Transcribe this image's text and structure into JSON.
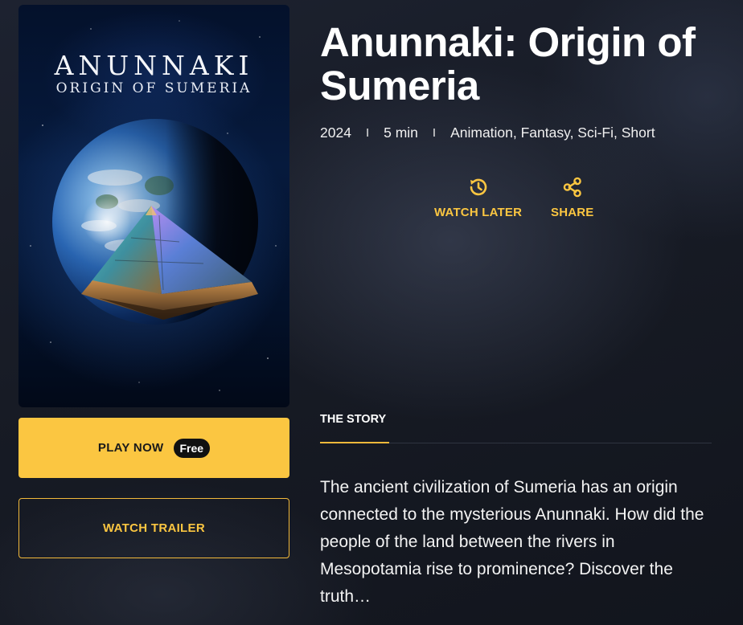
{
  "poster": {
    "title_line1": "ANUNNAKI",
    "title_line2": "ORIGIN OF SUMERIA"
  },
  "buttons": {
    "play_label": "PLAY NOW",
    "free_badge": "Free",
    "trailer_label": "WATCH TRAILER"
  },
  "movie": {
    "title": "Anunnaki: Origin of Sumeria",
    "year": "2024",
    "separator": "I",
    "duration": "5 min",
    "genres": "Animation, Fantasy, Sci-Fi, Short"
  },
  "actions": {
    "watch_later": "WATCH LATER",
    "share": "SHARE",
    "watch_later_icon": "history-clock-icon",
    "share_icon": "share-nodes-icon"
  },
  "tabs": {
    "story": "THE STORY"
  },
  "story": {
    "text": "The ancient civilization of Sumeria has an origin connected to the mysterious Anunnaki. How did the people of the land between the rivers in Mesopotamia rise to prominence? Discover the truth…"
  },
  "colors": {
    "accent": "#fbc641",
    "background": "#171b25"
  }
}
